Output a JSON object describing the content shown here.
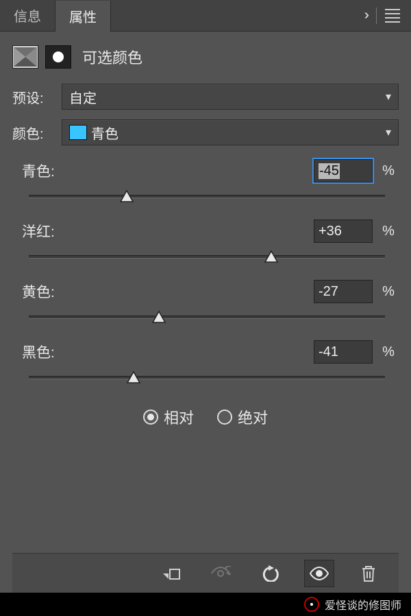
{
  "tabs": {
    "info": "信息",
    "properties": "属性"
  },
  "title": "可选颜色",
  "preset": {
    "label": "预设:",
    "value": "自定"
  },
  "color": {
    "label": "颜色:",
    "value": "青色",
    "swatch": "#38c4ff"
  },
  "sliders": {
    "cyan": {
      "label": "青色:",
      "value": "-45",
      "pct": -45
    },
    "magenta": {
      "label": "洋红:",
      "value": "+36",
      "pct": 36
    },
    "yellow": {
      "label": "黄色:",
      "value": "-27",
      "pct": -27
    },
    "black": {
      "label": "黑色:",
      "value": "-41",
      "pct": -41
    }
  },
  "mode": {
    "relative": "相对",
    "absolute": "绝对",
    "selected": "relative"
  },
  "percent_sign": "%",
  "watermark": "爱怪谈的修图师"
}
